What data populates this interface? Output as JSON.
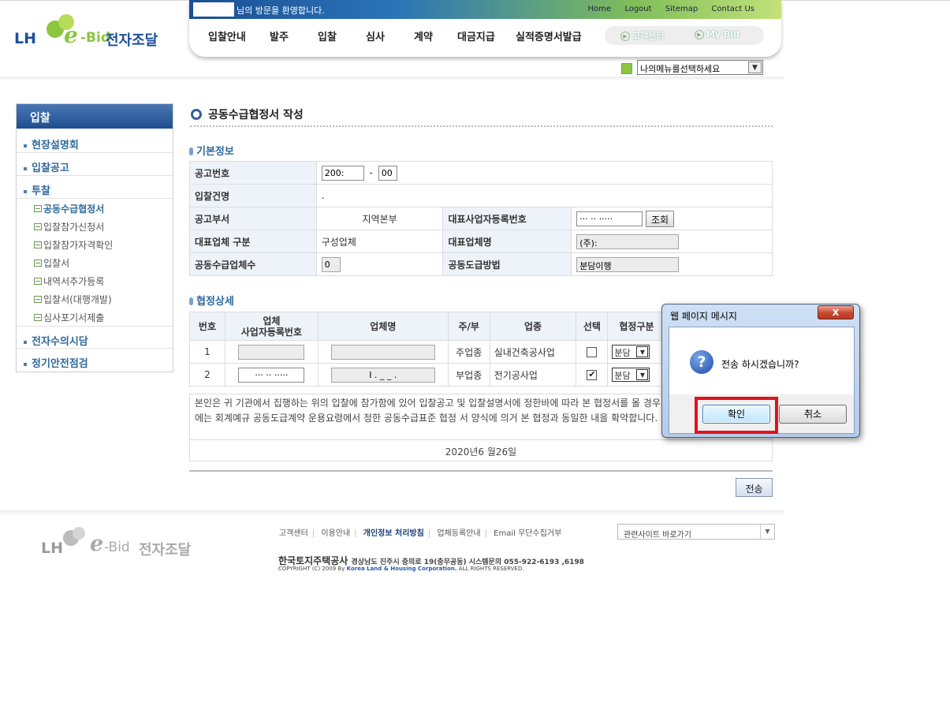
{
  "brand": {
    "lh": "LH",
    "e": "e",
    "bid": "-Bid",
    "name": "전자조달"
  },
  "header": {
    "welcome": "님의 방문을 환영합니다.",
    "top_links": [
      "Home",
      "Logout",
      "Sitemap",
      "Contact Us"
    ],
    "menu": [
      "입찰안내",
      "발주",
      "입찰",
      "심사",
      "계약",
      "대금지급",
      "실적증명서발급"
    ],
    "quick": [
      "고객센터",
      "My Bid"
    ],
    "my_menu_select": "나의메뉴를선택하세요"
  },
  "sidebar": {
    "title": "입찰",
    "items": [
      "현장설명회",
      "입찰공고",
      "투찰",
      "전자수의시담",
      "정기안전점검"
    ],
    "subitems": [
      "공동수급협정서",
      "입찰참가신청서",
      "입찰참가자격확인",
      "입찰서",
      "내역서추가등록",
      "입찰서(대행개발)",
      "심사포기서제출"
    ],
    "active_sub": "공동수급협정서"
  },
  "page": {
    "title": "공동수급협정서 작성",
    "basic_section": "기본정보",
    "detail_section": "협정상세"
  },
  "basic": {
    "notice_no_label": "공고번호",
    "notice_no_part1": "200:",
    "notice_no_sep": "-",
    "notice_no_part2": "00",
    "bid_name_label": "입찰건명",
    "bid_name_value": ".",
    "dept_label": "공고부서",
    "dept_value": "지역본부",
    "rep_regno_label": "대표사업자등록번호",
    "rep_regno_value": "··· ·· ·····",
    "lookup_btn": "조회",
    "rep_type_label": "대표업체 구분",
    "rep_type_value": "구성업체",
    "rep_name_label": "대표업체명",
    "rep_name_value": "(주):",
    "joint_count_label": "공동수급업체수",
    "joint_count_value": "0",
    "method_label": "공동도급방법",
    "method_value": "분담이행"
  },
  "detail": {
    "headers": [
      "번호",
      "업체\n사업자등록번호",
      "업체명",
      "주/부",
      "업종",
      "선택",
      "협정구분"
    ],
    "rows": [
      {
        "no": "1",
        "regno": "",
        "company": "",
        "role": "주업종",
        "industry": "실내건축공사업",
        "checked": false,
        "agreement": "분담"
      },
      {
        "no": "2",
        "regno": "··· ·· ·····",
        "company": "I .   _ _   .",
        "role": "부업종",
        "industry": "전기공사업",
        "checked": true,
        "agreement": "분담"
      }
    ]
  },
  "notice": {
    "text": "본인은 귀 기관에서 집행하는 위의 입찰에 참가함에 있어 입찰공고 및 입찰설명서에 정한바에 따라 본 협정서를 몰 경우에는 회계예규 공동도급계약 운용요령에서 정한 공동수급표준 협정 서 양식에 의거 본 협정과 동일한 내을 확약합니다.",
    "date": "2020년6 월26일"
  },
  "actions": {
    "send": "전송"
  },
  "footer": {
    "links": [
      "고객센터",
      "이용안내",
      "개인정보 처리방침",
      "업체등록안내",
      "Email 무단수집거부"
    ],
    "company": "한국토지주택공사",
    "address": "경상남도 진주시 충의로 19(충무공동) 시스템문의 055-922-6193 ,6198",
    "copyright_pre": "COPYRIGHT (C) 2009 By",
    "copyright_org": "Korea Land & Housing Corporation.",
    "copyright_post": "ALL RIGHTS RESERVED.",
    "related_sites": "관련사이트 바로가기"
  },
  "dialog": {
    "title": "웹 페이지 메시지",
    "close": "X",
    "message": "전송 하시겠습니까?",
    "ok": "확인",
    "cancel": "취소"
  }
}
